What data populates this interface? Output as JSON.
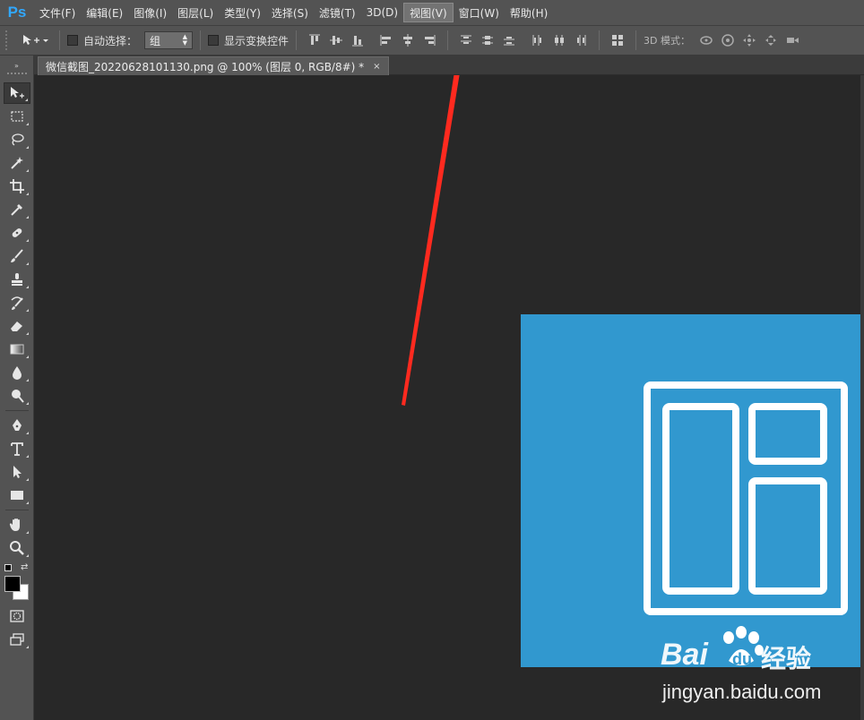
{
  "app": {
    "logo": "Ps"
  },
  "menu": [
    "文件(F)",
    "编辑(E)",
    "图像(I)",
    "图层(L)",
    "类型(Y)",
    "选择(S)",
    "滤镜(T)",
    "3D(D)",
    "视图(V)",
    "窗口(W)",
    "帮助(H)"
  ],
  "menu_active": "视图(V)",
  "options": {
    "auto_select_label": "自动选择：",
    "auto_select_value": "组",
    "show_transform_label": "显示变换控件",
    "mode3d_label": "3D 模式："
  },
  "document": {
    "tab_title": "微信截图_20220628101130.png @ 100% (图层 0, RGB/8#) *",
    "close_glyph": "×"
  },
  "watermark": {
    "brand_latin_1": "Bai",
    "brand_latin_2": "du",
    "brand_cn": "经验",
    "url": "jingyan.baidu.com"
  },
  "colors": {
    "accent_arrow": "#ff2a1f",
    "image_bg": "#3198cf",
    "canvas_bg": "#282828",
    "ps_blue": "#31a8ff"
  },
  "icons": {
    "tools": [
      "move-tool-icon",
      "marquee-tool-icon",
      "lasso-tool-icon",
      "magic-wand-icon",
      "crop-tool-icon",
      "eyedropper-icon",
      "healing-brush-icon",
      "brush-tool-icon",
      "clone-stamp-icon",
      "history-brush-icon",
      "eraser-icon",
      "gradient-tool-icon",
      "blur-tool-icon",
      "dodge-tool-icon",
      "pen-tool-icon",
      "type-tool-icon",
      "path-selection-icon",
      "rectangle-tool-icon",
      "hand-tool-icon",
      "zoom-tool-icon"
    ]
  }
}
